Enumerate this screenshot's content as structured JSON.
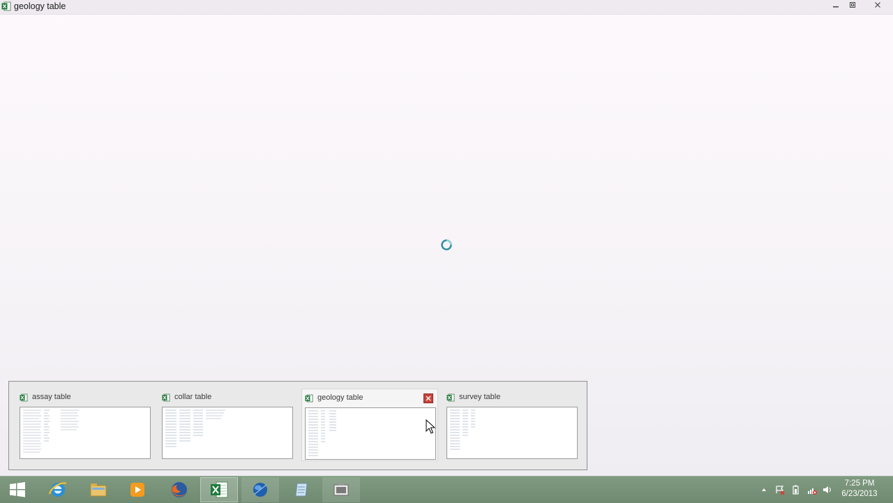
{
  "window": {
    "title": "geology table"
  },
  "thumbnails": [
    {
      "label": "assay table",
      "hovered": false
    },
    {
      "label": "collar table",
      "hovered": false
    },
    {
      "label": "geology table",
      "hovered": true
    },
    {
      "label": "survey table",
      "hovered": false
    }
  ],
  "taskbar": {
    "apps": [
      "start-icon",
      "internet-explorer-icon",
      "file-explorer-icon",
      "media-player-icon",
      "firefox-icon",
      "excel-icon",
      "globe-app-icon",
      "notepad-icon",
      "video-app-icon"
    ],
    "clock": {
      "time": "7:25 PM",
      "date": "6/23/2013"
    }
  },
  "colors": {
    "taskbar": "#76917a",
    "close_red": "#c7433b",
    "excel_green": "#1f7a3c"
  }
}
